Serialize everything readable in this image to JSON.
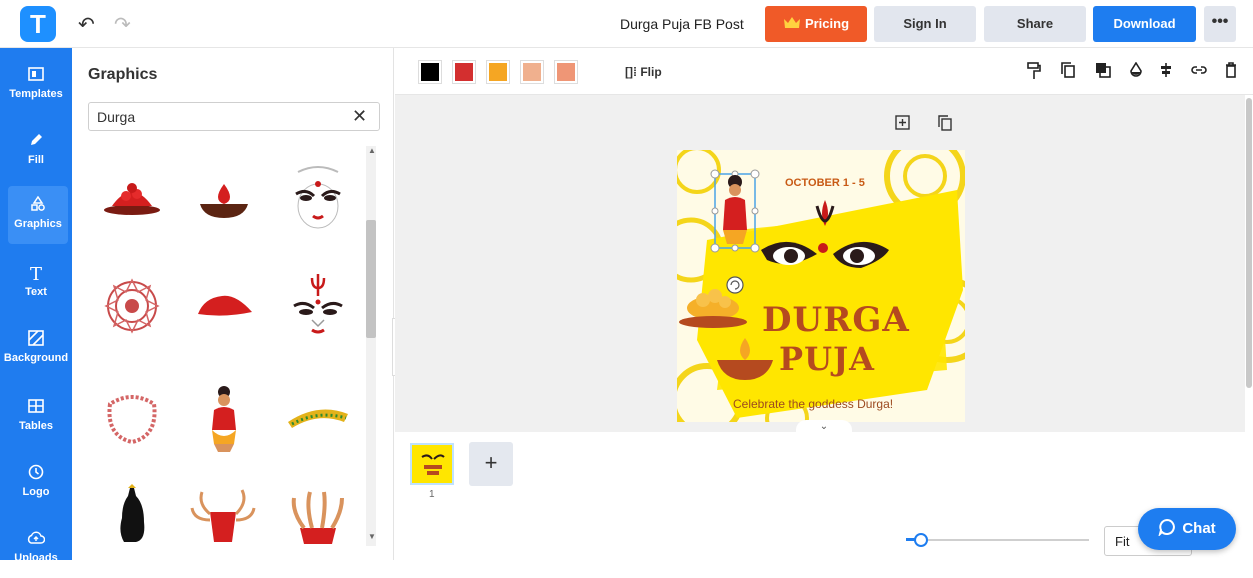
{
  "topbar": {
    "logo_letter": "T",
    "undo_glyph": "↶",
    "redo_glyph": "↷",
    "doc_title": "Durga Puja FB Post",
    "pricing_label": "Pricing",
    "signin_label": "Sign In",
    "share_label": "Share",
    "download_label": "Download",
    "more_label": "•••"
  },
  "sidebar": {
    "items": [
      {
        "label": "Templates",
        "icon": "templates-icon"
      },
      {
        "label": "Fill",
        "icon": "pencil-icon"
      },
      {
        "label": "Graphics",
        "icon": "shapes-icon"
      },
      {
        "label": "Text",
        "icon": "text-icon"
      },
      {
        "label": "Background",
        "icon": "background-icon"
      },
      {
        "label": "Tables",
        "icon": "table-icon"
      },
      {
        "label": "Logo",
        "icon": "logo-icon"
      },
      {
        "label": "Uploads",
        "icon": "upload-icon"
      }
    ]
  },
  "panel": {
    "title": "Graphics",
    "search_value": "Durga",
    "clear_glyph": "✕"
  },
  "toolbar": {
    "colors": [
      "#000000",
      "#d32f2f",
      "#f5a623",
      "#f0b08e",
      "#ef9676"
    ],
    "flip_label": "Flip"
  },
  "canvas": {
    "date": "OCTOBER 1 - 5",
    "title_line1": "DURGA",
    "title_line2": "PUJA",
    "tagline": "Celebrate the goddess Durga!"
  },
  "pages": {
    "page_number": "1",
    "add_label": "+"
  },
  "zoom": {
    "fit_label": "Fit"
  },
  "chat": {
    "label": "Chat"
  }
}
